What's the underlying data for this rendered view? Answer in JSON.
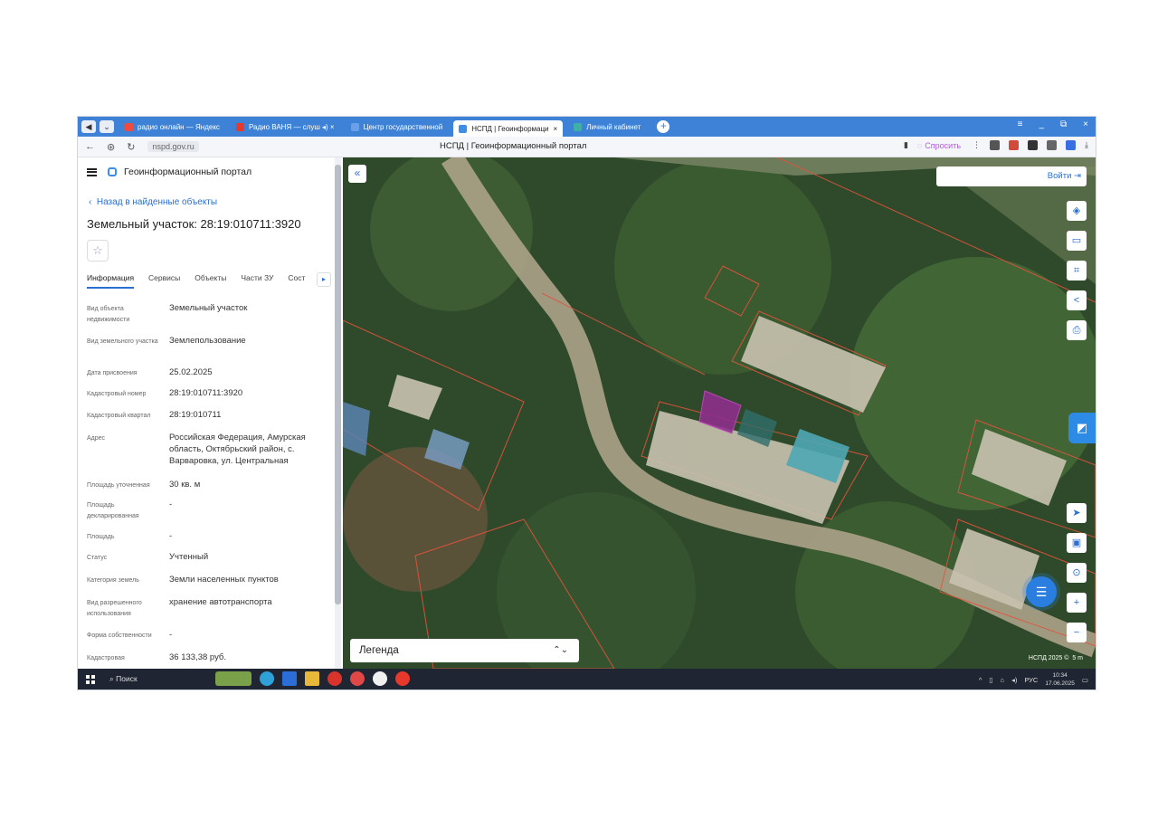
{
  "browser": {
    "tabs": [
      {
        "label": "радио онлайн — Яндекс",
        "color": "#f04b3c",
        "active": false
      },
      {
        "label": "Радио ВАНЯ — слуш ◂) ×",
        "color": "#e63a2e",
        "active": false
      },
      {
        "label": "Центр государственной",
        "color": "#6aa0e8",
        "active": false
      },
      {
        "label": "НСПД | Геоинформаци",
        "color": "#3b8fe6",
        "active": true
      },
      {
        "label": "Личный кабинет",
        "color": "#3fb0a8",
        "active": false
      }
    ],
    "url": "nspd.gov.ru",
    "page_title": "НСПД | Геоинформационный портал",
    "ask_label": "Спросить"
  },
  "panel": {
    "portal_name": "Геоинформационный портал",
    "back_link": "Назад в найденные объекты",
    "title": "Земельный участок: 28:19:010711:3920",
    "tabs": [
      "Информация",
      "Сервисы",
      "Объекты",
      "Части ЗУ",
      "Сост"
    ],
    "rows": [
      {
        "k": "Вид объекта недвижимости",
        "v": "Земельный участок"
      },
      {
        "k": "Вид земельного участка",
        "v": "Землепользование"
      },
      {
        "k": "Дата присвоения",
        "v": "25.02.2025"
      },
      {
        "k": "Кадастровый номер",
        "v": "28:19:010711:3920"
      },
      {
        "k": "Кадастровый квартал",
        "v": "28:19:010711"
      },
      {
        "k": "Адрес",
        "v": "Российская Федерация, Амурская область, Октябрьский район, с. Варваровка, ул. Центральная"
      },
      {
        "k": "Площадь уточненная",
        "v": "30 кв. м"
      },
      {
        "k": "Площадь декларированная",
        "v": "-"
      },
      {
        "k": "Площадь",
        "v": "-"
      },
      {
        "k": "Статус",
        "v": "Учтенный"
      },
      {
        "k": "Категория земель",
        "v": "Земли населенных пунктов"
      },
      {
        "k": "Вид разрешенного использования",
        "v": "хранение автотранспорта"
      },
      {
        "k": "Форма собственности",
        "v": "-"
      },
      {
        "k": "Кадастровая",
        "v": "36 133,38 руб."
      }
    ]
  },
  "map": {
    "login_label": "Войти",
    "legend_label": "Легенда",
    "attribution": "НСПД 2025 ©",
    "scale_label": "5 m"
  },
  "taskbar": {
    "search_label": "Поиск",
    "lang": "РУС",
    "time": "10:34",
    "date": "17.06.2025"
  }
}
